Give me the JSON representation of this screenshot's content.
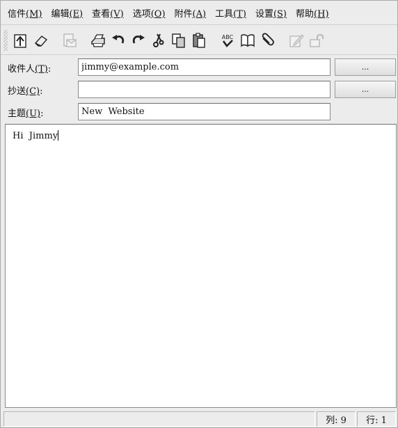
{
  "menu": [
    {
      "label": "信件",
      "key": "(M)"
    },
    {
      "label": "编辑",
      "key": "(E)"
    },
    {
      "label": "查看",
      "key": "(V)"
    },
    {
      "label": "选项",
      "key": "(O)"
    },
    {
      "label": "附件",
      "key": "(A)"
    },
    {
      "label": "工具",
      "key": "(T)"
    },
    {
      "label": "设置",
      "key": "(S)"
    },
    {
      "label": "帮助",
      "key": "(H)"
    }
  ],
  "toolbar": {
    "icons": [
      "send-icon",
      "eraser-icon",
      "save-draft-icon",
      "print-icon",
      "undo-icon",
      "redo-icon",
      "cut-icon",
      "copy-icon",
      "paste-icon",
      "spellcheck-icon",
      "address-book-icon",
      "attach-icon",
      "sign-icon",
      "encrypt-icon"
    ]
  },
  "fields": {
    "to": {
      "label": "收件人",
      "key": "(T)",
      "colon": ":",
      "value": "jimmy@example.com",
      "button": "..."
    },
    "cc": {
      "label": "抄送",
      "key": "(C)",
      "colon": ":",
      "value": "",
      "button": "..."
    },
    "subject": {
      "label": "主题",
      "key": "(U)",
      "colon": ":",
      "value": "New  Website"
    }
  },
  "body": {
    "text": "Hi  Jimmy"
  },
  "status": {
    "col": "列:  9",
    "row": "行:  1"
  },
  "colors": {
    "window": "#ececec",
    "field_bg": "#ffffff",
    "border": "#8a8a8a"
  }
}
